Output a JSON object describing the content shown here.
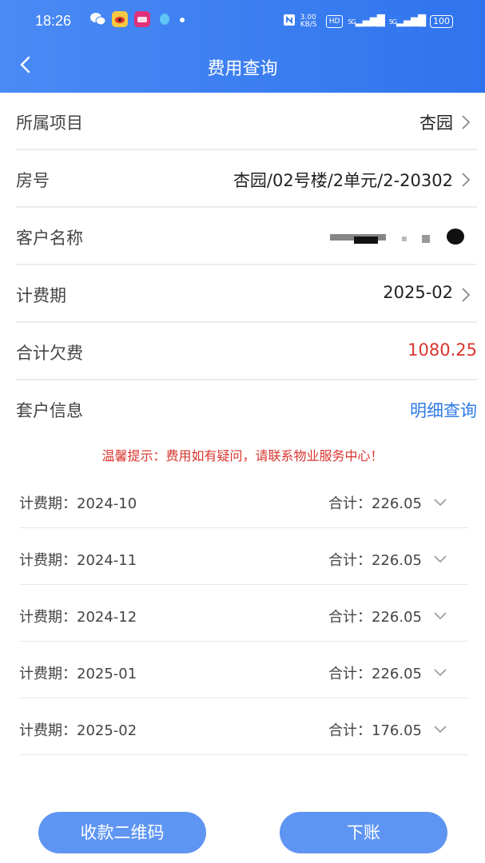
{
  "status_bar": {
    "time": "18:26",
    "network_speed": "3.00 KB/S",
    "battery": "100",
    "signal1": "5G",
    "signal2": "5G",
    "hd": "HD"
  },
  "header": {
    "title": "费用查询"
  },
  "form": {
    "project_label": "所属项目",
    "project_value": "杏园",
    "room_label": "房号",
    "room_value": "杏园/02号楼/2单元/2-20302",
    "customer_label": "客户名称",
    "period_label": "计费期",
    "period_value": "2025-02",
    "arrears_label": "合计欠费",
    "arrears_value": "1080.25",
    "suite_label": "套户信息",
    "suite_link": "明细查询"
  },
  "tip": "温馨提示：费用如有疑问，请联系物业服务中心！",
  "bills": [
    {
      "period": "计费期：2024-10",
      "total": "合计：226.05"
    },
    {
      "period": "计费期：2024-11",
      "total": "合计：226.05"
    },
    {
      "period": "计费期：2024-12",
      "total": "合计：226.05"
    },
    {
      "period": "计费期：2025-01",
      "total": "合计：226.05"
    },
    {
      "period": "计费期：2025-02",
      "total": "合计：176.05"
    }
  ],
  "buttons": {
    "qr_label": "收款二维码",
    "writeoff_label": "下账"
  },
  "colors": {
    "primary": "#2f74ee",
    "button": "#5f95f2",
    "warning": "#d9352e",
    "link": "#2f7ae5"
  }
}
